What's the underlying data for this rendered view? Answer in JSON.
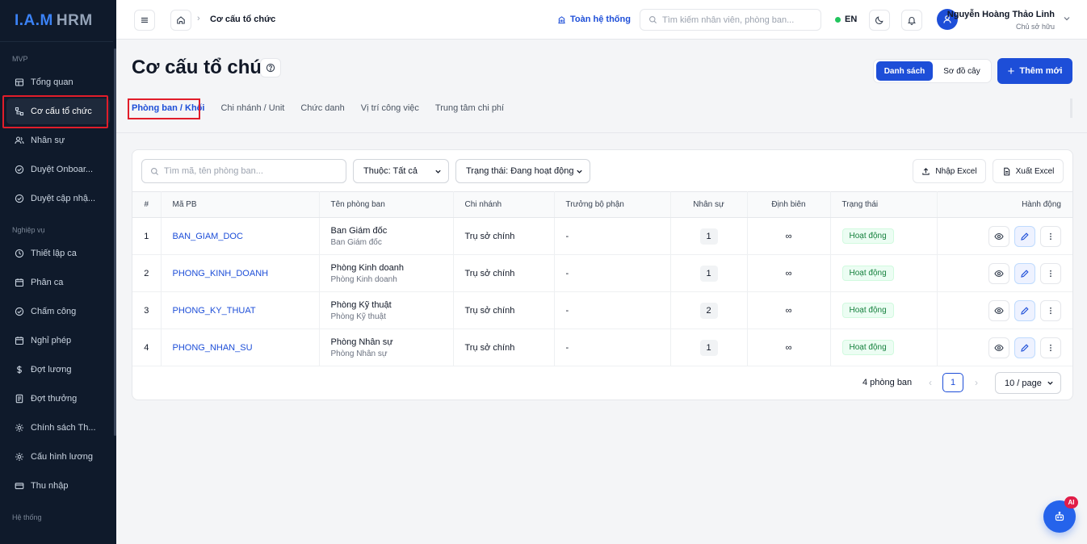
{
  "logo": {
    "part1": "I.A.M",
    "part2": "HRM"
  },
  "sidebar": {
    "sections": [
      {
        "label": "MVP",
        "items": [
          {
            "label": "Tổng quan",
            "icon": "dashboard-icon"
          },
          {
            "label": "Cơ cấu tổ chức",
            "icon": "org-chart-icon",
            "active": true
          },
          {
            "label": "Nhân sự",
            "icon": "users-icon"
          },
          {
            "label": "Duyệt Onboar...",
            "icon": "check-circle-icon"
          },
          {
            "label": "Duyệt cập nhậ...",
            "icon": "check-circle-icon"
          }
        ]
      },
      {
        "label": "Nghiệp vụ",
        "items": [
          {
            "label": "Thiết lập ca",
            "icon": "clock-icon"
          },
          {
            "label": "Phân ca",
            "icon": "calendar-icon"
          },
          {
            "label": "Chấm công",
            "icon": "check-circle-icon"
          },
          {
            "label": "Nghỉ phép",
            "icon": "calendar-icon"
          },
          {
            "label": "Đợt lương",
            "icon": "dollar-icon"
          },
          {
            "label": "Đợt thưởng",
            "icon": "receipt-icon"
          },
          {
            "label": "Chính sách Th...",
            "icon": "gear-icon"
          },
          {
            "label": "Cấu hình lương",
            "icon": "gear-icon"
          },
          {
            "label": "Thu nhập",
            "icon": "card-icon"
          }
        ]
      },
      {
        "label": "Hệ thống",
        "items": []
      }
    ]
  },
  "topbar": {
    "breadcrumb_current": "Cơ cấu tổ chức",
    "breadcrumb_separator": "›",
    "scope_label": "Toàn hệ thống",
    "search_placeholder": "Tìm kiếm nhân viên, phòng ban...",
    "language": "EN",
    "user_name": "Nguyễn Hoàng Thảo Linh",
    "user_role": "Chủ sở hữu"
  },
  "page": {
    "title": "Cơ cấu tổ chức",
    "view_list": "Danh sách",
    "view_tree": "Sơ đồ cây",
    "add_label": "Thêm mới",
    "add_plus": "+"
  },
  "tabs": [
    "Phòng ban / Khối",
    "Chi nhánh / Unit",
    "Chức danh",
    "Vị trí công việc",
    "Trung tâm chi phí"
  ],
  "filters": {
    "search_placeholder": "Tìm mã, tên phòng ban...",
    "belongs": "Thuộc: Tất cả",
    "status": "Trạng thái: Đang hoạt động",
    "import_label": "Nhập Excel",
    "export_label": "Xuất Excel"
  },
  "table": {
    "headers": [
      "#",
      "Mã PB",
      "Tên phòng ban",
      "Chi nhánh",
      "Trưởng bộ phận",
      "Nhân sự",
      "Định biên",
      "Trạng thái",
      "Hành động"
    ],
    "rows": [
      {
        "idx": "1",
        "code": "BAN_GIAM_DOC",
        "name": "Ban Giám đốc",
        "sub": "Ban Giám đốc",
        "branch": "Trụ sở chính",
        "head": "-",
        "staff": "1",
        "quota": "∞",
        "status": "Hoạt động"
      },
      {
        "idx": "2",
        "code": "PHONG_KINH_DOANH",
        "name": "Phòng Kinh doanh",
        "sub": "Phòng Kinh doanh",
        "branch": "Trụ sở chính",
        "head": "-",
        "staff": "1",
        "quota": "∞",
        "status": "Hoạt động"
      },
      {
        "idx": "3",
        "code": "PHONG_KY_THUAT",
        "name": "Phòng Kỹ thuật",
        "sub": "Phòng Kỹ thuật",
        "branch": "Trụ sở chính",
        "head": "-",
        "staff": "2",
        "quota": "∞",
        "status": "Hoạt động"
      },
      {
        "idx": "4",
        "code": "PHONG_NHAN_SU",
        "name": "Phòng Nhân sự",
        "sub": "Phòng Nhân sự",
        "branch": "Trụ sở chính",
        "head": "-",
        "staff": "1",
        "quota": "∞",
        "status": "Hoạt động"
      }
    ]
  },
  "pagination": {
    "total": "4 phòng ban",
    "current_page": "1",
    "page_size": "10 / page",
    "prev": "‹",
    "next": "›"
  },
  "ai_badge": "AI",
  "colors": {
    "primary": "#1d4ed8",
    "sidebar": "#0f1a2b",
    "highlight": "#e11d2a",
    "success": "#15803d"
  }
}
